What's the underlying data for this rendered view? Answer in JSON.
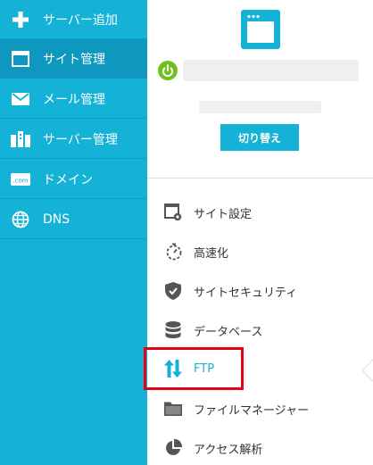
{
  "sidebar": {
    "items": [
      {
        "label": "サーバー追加",
        "icon": "plus-icon"
      },
      {
        "label": "サイト管理",
        "icon": "browser-window-icon",
        "active": true
      },
      {
        "label": "メール管理",
        "icon": "envelope-icon"
      },
      {
        "label": "サーバー管理",
        "icon": "server-icon"
      },
      {
        "label": "ドメイン",
        "icon": "domain-tag-icon",
        "icon_text": ".com"
      },
      {
        "label": "DNS",
        "icon": "globe-icon"
      }
    ],
    "background": "#15b2d8",
    "active_background": "#0e97bf"
  },
  "panel": {
    "site_icon": "browser-window-icon",
    "status_icon": "power-icon",
    "status_color": "#6fbf1d",
    "switch_button": "切り替え",
    "menu": [
      {
        "label": "サイト設定",
        "icon": "site-settings-icon"
      },
      {
        "label": "高速化",
        "icon": "stopwatch-icon"
      },
      {
        "label": "サイトセキュリティ",
        "icon": "shield-check-icon"
      },
      {
        "label": "データベース",
        "icon": "database-icon"
      },
      {
        "label": "FTP",
        "icon": "transfer-arrows-icon",
        "highlighted": true
      },
      {
        "label": "ファイルマネージャー",
        "icon": "folder-icon"
      },
      {
        "label": "アクセス解析",
        "icon": "pie-chart-icon"
      }
    ]
  },
  "colors": {
    "accent": "#15b2d8",
    "highlight_box": "#e60012",
    "menu_text": "#333333"
  }
}
